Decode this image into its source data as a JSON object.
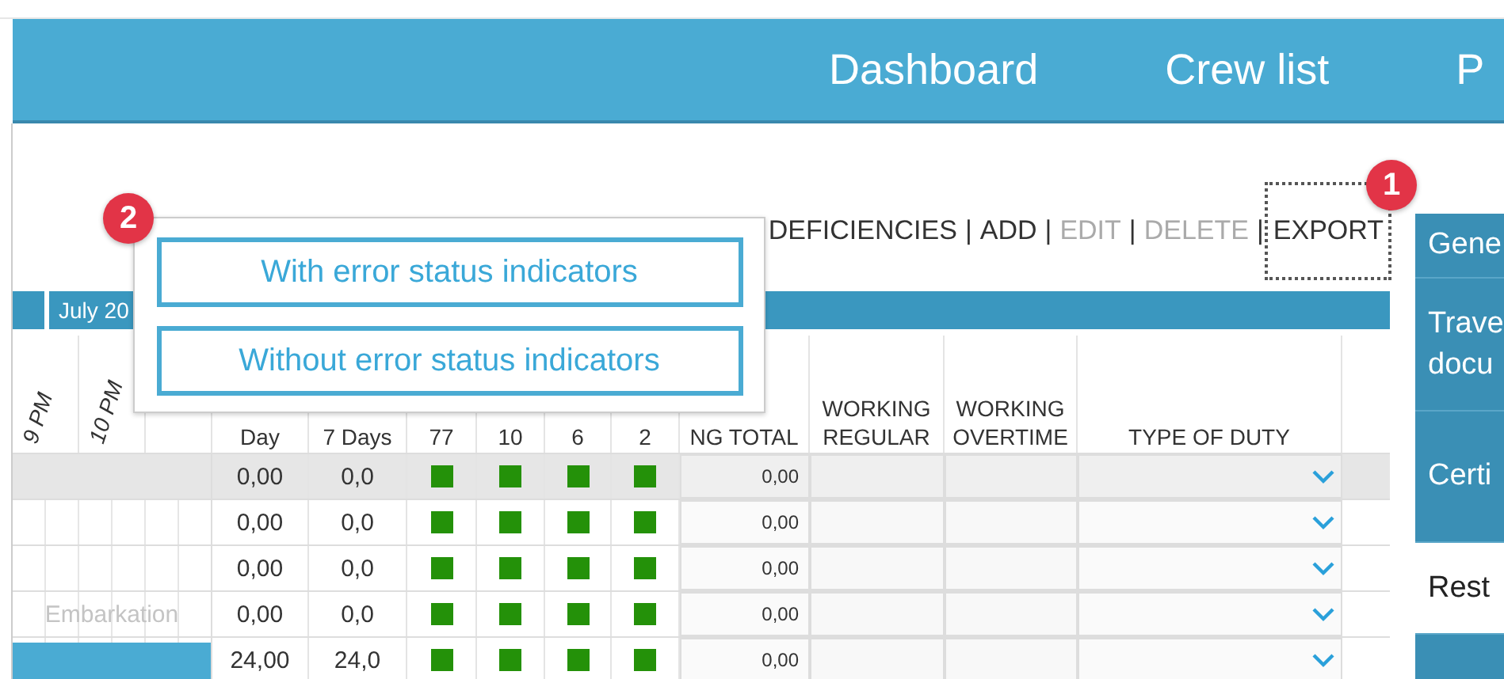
{
  "nav": {
    "items": [
      "Dashboard",
      "Crew list",
      "P"
    ]
  },
  "toolbar": {
    "separator": "|",
    "actions": [
      {
        "label": "DEFICIENCIES",
        "disabled": false,
        "focused": false
      },
      {
        "label": "ADD",
        "disabled": false,
        "focused": false
      },
      {
        "label": "EDIT",
        "disabled": true,
        "focused": false
      },
      {
        "label": "DELETE",
        "disabled": true,
        "focused": false
      },
      {
        "label": "EXPORT",
        "disabled": false,
        "focused": true,
        "badge": "1"
      }
    ]
  },
  "date_bar": {
    "label": "July 20"
  },
  "table": {
    "hour_columns": [
      "9 PM",
      "10 PM"
    ],
    "columns": [
      "Day",
      "7 Days",
      "77",
      "10",
      "6",
      "2",
      "NG TOTAL",
      "WORKING REGULAR",
      "WORKING OVERTIME",
      "TYPE OF DUTY"
    ],
    "rows": [
      {
        "selected": true,
        "day": "0,00",
        "week": "0,0",
        "checks": [
          true,
          true,
          true,
          true
        ],
        "total": "0,00"
      },
      {
        "selected": false,
        "day": "0,00",
        "week": "0,0",
        "checks": [
          true,
          true,
          true,
          true
        ],
        "total": "0,00"
      },
      {
        "selected": false,
        "day": "0,00",
        "week": "0,0",
        "checks": [
          true,
          true,
          true,
          true
        ],
        "total": "0,00"
      },
      {
        "selected": false,
        "timeline": {
          "kind": "label",
          "text": "Embarkation"
        },
        "day": "0,00",
        "week": "0,0",
        "checks": [
          true,
          true,
          true,
          true
        ],
        "total": "0,00"
      },
      {
        "selected": false,
        "timeline": {
          "kind": "bar"
        },
        "day": "24,00",
        "week": "24,0",
        "checks": [
          true,
          true,
          true,
          true
        ],
        "total": "0,00"
      }
    ]
  },
  "sidebar": {
    "items": [
      {
        "label": "Gene",
        "selected": false
      },
      {
        "label": "Trave\ndocu",
        "selected": false
      },
      {
        "label": "Certi",
        "selected": false
      },
      {
        "label": "Rest",
        "selected": true
      },
      {
        "selected": false
      }
    ]
  },
  "export_menu": {
    "badge": "2",
    "options": [
      "With error status indicators",
      "Without error status indicators"
    ]
  }
}
